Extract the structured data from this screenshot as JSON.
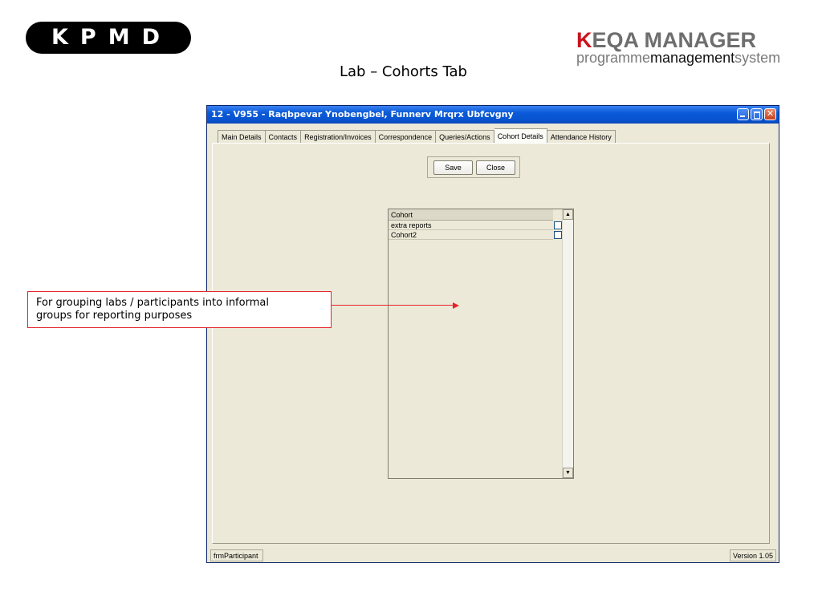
{
  "header": {
    "kpmd_logo": "KPMD",
    "eqa_logo_title": "EQA MANAGER",
    "eqa_logo_k": "K",
    "eqa_logo_sub_1": "programme",
    "eqa_logo_sub_2": "management",
    "eqa_logo_sub_3": "system",
    "slide_title": "Lab – Cohorts Tab"
  },
  "window": {
    "title": "12 - V955 - Raqbpevar Ynobengbel, Funnerv Mrqrx Ubfcvgny",
    "tabs": [
      {
        "label": "Main Details"
      },
      {
        "label": "Contacts"
      },
      {
        "label": "Registration/Invoices"
      },
      {
        "label": "Correspondence"
      },
      {
        "label": "Queries/Actions"
      },
      {
        "label": "Cohort Details"
      },
      {
        "label": "Attendance History"
      }
    ],
    "active_tab": "Cohort Details",
    "save_label": "Save",
    "close_label": "Close",
    "grid": {
      "header": "Cohort",
      "rows": [
        {
          "name": "extra reports",
          "checked": false
        },
        {
          "name": "Cohort2",
          "checked": false
        }
      ]
    },
    "status_left": "frmParticipant",
    "status_right": "Version 1.05"
  },
  "annotation": {
    "line1": "For grouping labs / participants into informal",
    "line2": "groups for reporting purposes"
  },
  "colors": {
    "titlebar": "#0a5ad7",
    "window_bg": "#ece9d8",
    "annotation_red": "#e3262a",
    "eqa_red": "#c8141e"
  }
}
